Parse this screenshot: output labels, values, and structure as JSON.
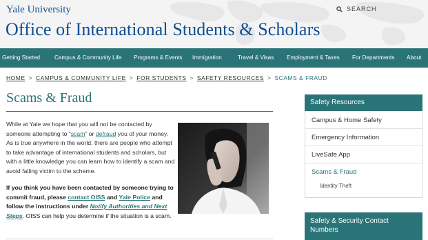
{
  "header": {
    "university": "Yale University",
    "office": "Office of International Students & Scholars",
    "search_label": "SEARCH"
  },
  "nav": {
    "items": [
      "Getting Started",
      "Campus & Community Life",
      "Programs & Events",
      "Immigration",
      "Travel & Visas",
      "Employment & Taxes",
      "For Departments",
      "About"
    ]
  },
  "breadcrumb": {
    "items": [
      "Home",
      "Campus & Community Life",
      "For Students",
      "Safety Resources"
    ],
    "current": "Scams & Fraud",
    "separator": ">"
  },
  "page": {
    "title": "Scams & Fraud",
    "p1_a": "While at Yale we hope that you will not be contacted by someone attempting to “",
    "p1_scam": "scam",
    "p1_b": "” or ",
    "p1_defraud": "defraud",
    "p1_c": " you of your money. As is true anywhere in the world, there are people who attempt to take advantage of international students and scholars, but with a little knowledge you can learn how to identify a scam and avoid falling victim to the scheme.",
    "p2_a": "If you think you have been contacted by someone trying to commit fraud, please ",
    "p2_oiss": "contact OISS",
    "p2_and": " and ",
    "p2_police": "Yale Police",
    "p2_b": " and follow the instructions under ",
    "p2_notify": "Notify Authorities and Next Steps",
    "p2_c": ". OISS can help you determine if the situation is a scam."
  },
  "sidebar": {
    "heading": "Safety Resources",
    "items": [
      "Campus & Home Safety",
      "Emergency Information",
      "LiveSafe App",
      "Scams & Fraud"
    ],
    "sub_item": "Identity Theft",
    "heading2": "Safety & Security Contact Numbers"
  },
  "colors": {
    "teal": "#2a7478",
    "yale_blue": "#0f4d92"
  }
}
